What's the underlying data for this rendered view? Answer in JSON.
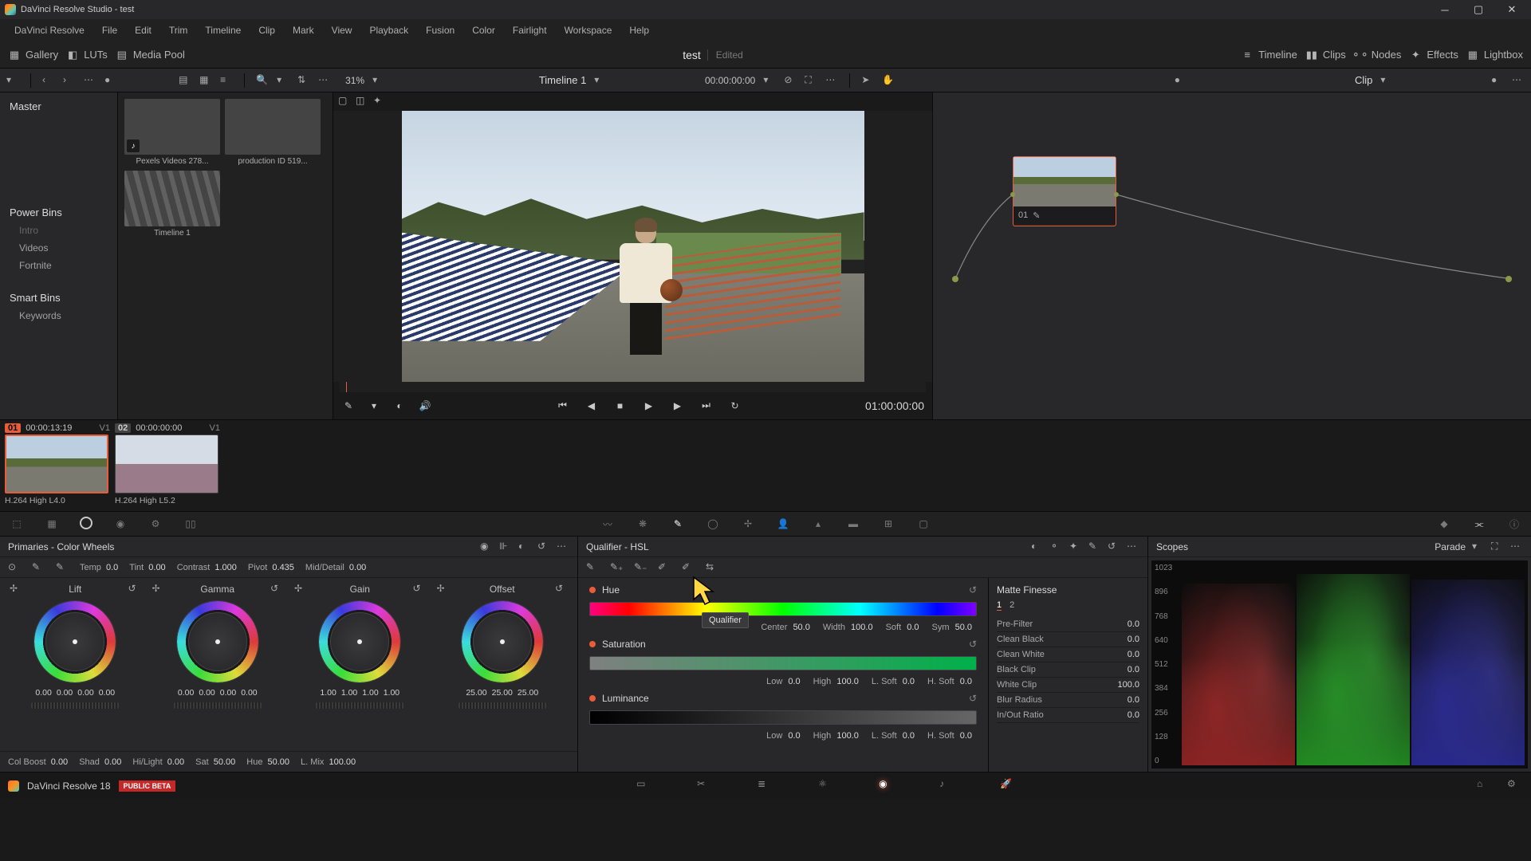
{
  "window": {
    "title": "DaVinci Resolve Studio - test"
  },
  "menu": [
    "DaVinci Resolve",
    "File",
    "Edit",
    "Trim",
    "Timeline",
    "Clip",
    "Mark",
    "View",
    "Playback",
    "Fusion",
    "Color",
    "Fairlight",
    "Workspace",
    "Help"
  ],
  "topbar": {
    "gallery": "Gallery",
    "luts": "LUTs",
    "mediapool": "Media Pool",
    "project": "test",
    "edited": "Edited",
    "timeline": "Timeline",
    "clips": "Clips",
    "nodes": "Nodes",
    "effects": "Effects",
    "lightbox": "Lightbox"
  },
  "secbar": {
    "zoom": "31%",
    "timeline": "Timeline 1",
    "tc": "00:00:00:00",
    "clipmode": "Clip"
  },
  "sidebar": {
    "master": "Master",
    "powerbins": "Power Bins",
    "powerbins_items": [
      "Intro",
      "Videos",
      "Fortnite"
    ],
    "smartbins": "Smart Bins",
    "smartbins_items": [
      "Keywords"
    ]
  },
  "media": {
    "items": [
      {
        "label": "Pexels Videos 278...",
        "kind": "runner"
      },
      {
        "label": "production ID 519...",
        "kind": "stadium"
      },
      {
        "label": "Timeline 1",
        "kind": "timeline"
      }
    ]
  },
  "transport": {
    "tc": "01:00:00:00"
  },
  "node": {
    "id": "01"
  },
  "clips": [
    {
      "idx": "01",
      "tc": "00:00:13:19",
      "track": "V1",
      "label": "H.264 High L4.0",
      "kind": "stadium",
      "active": true
    },
    {
      "idx": "02",
      "tc": "00:00:00:00",
      "track": "V1",
      "label": "H.264 High L5.2",
      "kind": "runner",
      "active": false
    }
  ],
  "wheels": {
    "title": "Primaries - Color Wheels",
    "params": {
      "temp": "0.0",
      "tint": "0.00",
      "contrast": "1.000",
      "pivot": "0.435",
      "middetail": "0.00"
    },
    "labels": {
      "temp": "Temp",
      "tint": "Tint",
      "contrast": "Contrast",
      "pivot": "Pivot",
      "middetail": "Mid/Detail"
    },
    "cols": [
      {
        "name": "Lift",
        "vals": [
          "0.00",
          "0.00",
          "0.00",
          "0.00"
        ]
      },
      {
        "name": "Gamma",
        "vals": [
          "0.00",
          "0.00",
          "0.00",
          "0.00"
        ]
      },
      {
        "name": "Gain",
        "vals": [
          "1.00",
          "1.00",
          "1.00",
          "1.00"
        ]
      },
      {
        "name": "Offset",
        "vals": [
          "25.00",
          "25.00",
          "25.00"
        ]
      }
    ],
    "footer": {
      "colboost": "0.00",
      "shad": "0.00",
      "hilight": "0.00",
      "sat": "50.00",
      "hue": "50.00",
      "lmix": "100.00"
    },
    "footer_labels": {
      "colboost": "Col Boost",
      "shad": "Shad",
      "hilight": "Hi/Light",
      "sat": "Sat",
      "hue": "Hue",
      "lmix": "L. Mix"
    }
  },
  "qualifier": {
    "title": "Qualifier - HSL",
    "tooltip": "Qualifier",
    "rows": {
      "hue": {
        "name": "Hue",
        "center": "50.0",
        "width": "100.0",
        "soft": "0.0",
        "sym": "50.0"
      },
      "sat": {
        "name": "Saturation",
        "low": "0.0",
        "high": "100.0",
        "lsoft": "0.0",
        "hsoft": "0.0"
      },
      "lum": {
        "name": "Luminance",
        "low": "0.0",
        "high": "100.0",
        "lsoft": "0.0",
        "hsoft": "0.0"
      }
    },
    "row_labels": {
      "center": "Center",
      "width": "Width",
      "soft": "Soft",
      "sym": "Sym",
      "low": "Low",
      "high": "High",
      "lsoft": "L. Soft",
      "hsoft": "H. Soft"
    },
    "matte": {
      "title": "Matte Finesse",
      "tabs": [
        "1",
        "2"
      ],
      "items": [
        {
          "label": "Pre-Filter",
          "value": "0.0"
        },
        {
          "label": "Clean Black",
          "value": "0.0"
        },
        {
          "label": "Clean White",
          "value": "0.0"
        },
        {
          "label": "Black Clip",
          "value": "0.0"
        },
        {
          "label": "White Clip",
          "value": "100.0"
        },
        {
          "label": "Blur Radius",
          "value": "0.0"
        },
        {
          "label": "In/Out Ratio",
          "value": "0.0"
        }
      ]
    }
  },
  "scopes": {
    "title": "Scopes",
    "mode": "Parade",
    "ticks": [
      "1023",
      "896",
      "768",
      "640",
      "512",
      "384",
      "256",
      "128",
      "0"
    ]
  },
  "bottom": {
    "product": "DaVinci Resolve 18",
    "beta": "PUBLIC BETA"
  }
}
